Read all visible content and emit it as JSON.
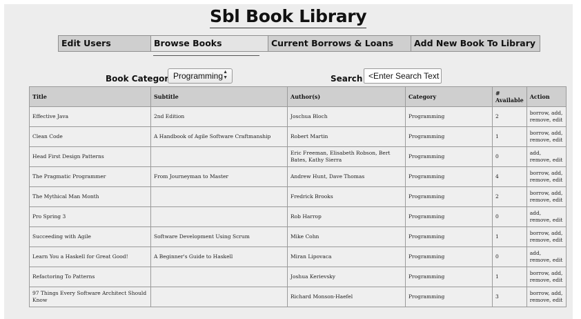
{
  "app": {
    "title": "Sbl Book Library"
  },
  "nav": {
    "items": [
      {
        "label": "Edit Users",
        "width": 134
      },
      {
        "label": "Browse Books",
        "width": 170
      },
      {
        "label": "Current Borrows & Loans",
        "width": 207
      },
      {
        "label": "Add New Book To Library",
        "width": 186
      }
    ],
    "active": "Browse Books"
  },
  "filters": {
    "category_label": "Book Category :",
    "category_value": "Programming",
    "search_label": "Search :",
    "search_value": "<Enter Search Text>"
  },
  "table": {
    "headers": [
      "Title",
      "Subtitle",
      "Author(s)",
      "Category",
      "# Available",
      "Action"
    ],
    "rows": [
      {
        "title": "Effective Java",
        "subtitle": "2nd Edition",
        "authors": "Joschua Bloch",
        "category": "Programming",
        "available": "2",
        "action": "borrow, add, remove, edit"
      },
      {
        "title": "Clean Code",
        "subtitle": "A Handbook of Agile Software Craftmanship",
        "authors": "Robert Martin",
        "category": "Programming",
        "available": "1",
        "action": "borrow, add, remove, edit"
      },
      {
        "title": "Head First Design Patterns",
        "subtitle": "",
        "authors": "Eric Freeman, Elisabeth Robson, Bert Bates, Kathy Sierra",
        "category": "Programming",
        "available": "0",
        "action": "add, remove, edit"
      },
      {
        "title": "The Pragmatic Programmer",
        "subtitle": "From Journeyman to Master",
        "authors": "Andrew Hunt, Dave Thomas",
        "category": "Programming",
        "available": "4",
        "action": "borrow, add, remove, edit"
      },
      {
        "title": "The Mythical Man Month",
        "subtitle": "",
        "authors": "Fredrick Brooks",
        "category": "Programming",
        "available": "2",
        "action": "borrow, add, remove, edit"
      },
      {
        "title": "Pro Spring 3",
        "subtitle": "",
        "authors": "Rob Harrop",
        "category": "Programming",
        "available": "0",
        "action": "add, remove, edit"
      },
      {
        "title": "Succeeding with Agile",
        "subtitle": "Software Development Using Scrum",
        "authors": "Mike Cohn",
        "category": "Programming",
        "available": "1",
        "action": "borrow, add, remove, edit"
      },
      {
        "title": "Learn You a Haskell for Great Good!",
        "subtitle": "A Beginner's Guide to Haskell",
        "authors": "Miran Lipovaca",
        "category": "Programming",
        "available": "0",
        "action": "add, remove, edit"
      },
      {
        "title": "Refactoring To Patterns",
        "subtitle": "",
        "authors": "Joshua Kerievsky",
        "category": "Programming",
        "available": "1",
        "action": "borrow, add, remove, edit"
      },
      {
        "title": "97 Things Every Software Architect Should Know",
        "subtitle": "",
        "authors": "Richard Monson-Haefel",
        "category": "Programming",
        "available": "3",
        "action": "borrow, add, remove, edit"
      }
    ]
  }
}
